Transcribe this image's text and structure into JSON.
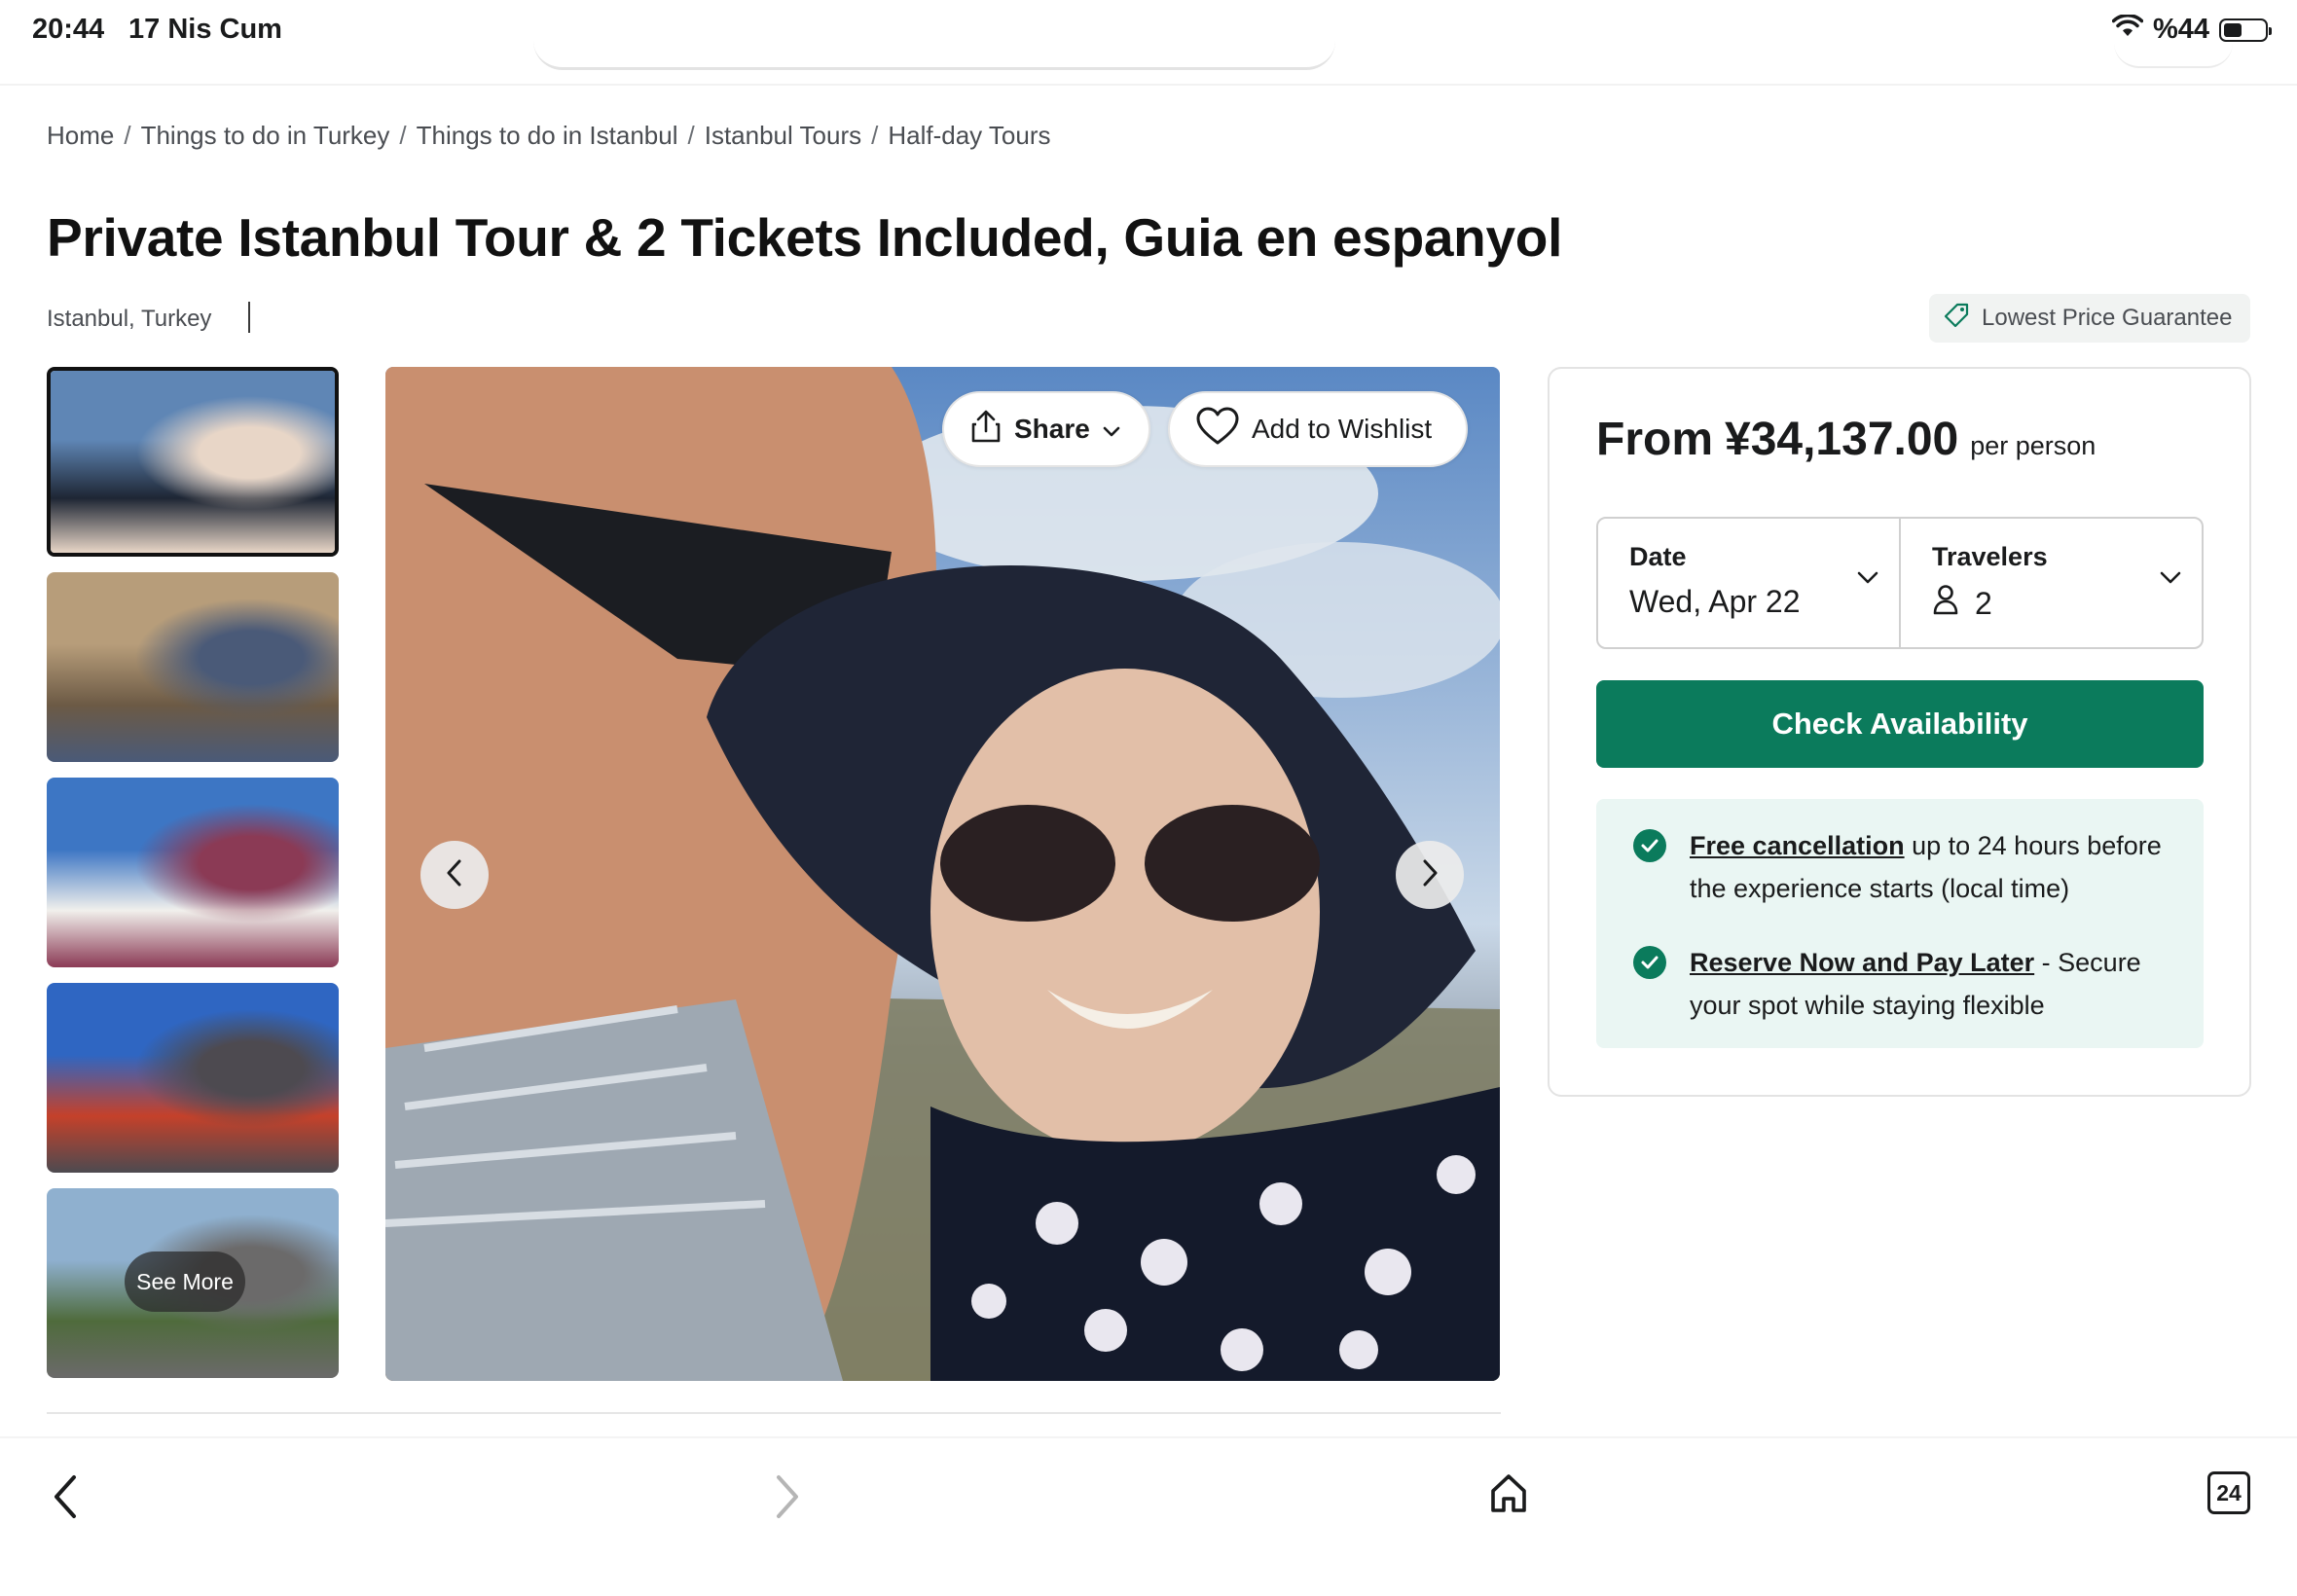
{
  "status_bar": {
    "time": "20:44",
    "date": "17 Nis Cum",
    "battery_text": "%44",
    "battery_level": 0.44
  },
  "breadcrumb": [
    "Home",
    "Things to do in Turkey",
    "Things to do in Istanbul",
    "Istanbul Tours",
    "Half-day Tours"
  ],
  "breadcrumb_separator": "/",
  "title": "Private Istanbul Tour & 2 Tickets Included, Guia en espanyol",
  "location": "Istanbul, Turkey",
  "badge": {
    "label": "Lowest Price Guarantee",
    "icon": "tag-icon"
  },
  "gallery": {
    "thumbnails": [
      {
        "name": "selfie-couple",
        "colors": [
          "#5f86b5",
          "#1e2634",
          "#e8d6c7"
        ],
        "selected": true
      },
      {
        "name": "ancient-library-group",
        "colors": [
          "#b79d7a",
          "#6c5a45",
          "#4a5a78"
        ],
        "selected": false
      },
      {
        "name": "pamukkale-group",
        "colors": [
          "#3d76c4",
          "#f1f0ec",
          "#8b3a55"
        ],
        "selected": false
      },
      {
        "name": "tower-group",
        "colors": [
          "#2f66c2",
          "#c5412a",
          "#4d4a50"
        ],
        "selected": false
      },
      {
        "name": "temple-group",
        "colors": [
          "#8fb0cf",
          "#4f6b3c",
          "#6b6a6a"
        ],
        "selected": false
      }
    ],
    "see_more_label": "See More",
    "share_label": "Share",
    "wishlist_label": "Add to Wishlist"
  },
  "booking": {
    "from_label": "From",
    "price": "¥34,137.00",
    "price_unit": "per person",
    "date_label": "Date",
    "date_value": "Wed, Apr 22",
    "travelers_label": "Travelers",
    "travelers_value": "2",
    "cta_label": "Check Availability",
    "cta_color": "#0b7b5c",
    "benefits": [
      {
        "title": "Free cancellation",
        "text": " up to 24 hours before the experience starts (local time)"
      },
      {
        "title": "Reserve Now and Pay Later",
        "text": " - Secure your spot while staying flexible"
      }
    ]
  },
  "bottom_bar": {
    "tabs_count": "24"
  }
}
